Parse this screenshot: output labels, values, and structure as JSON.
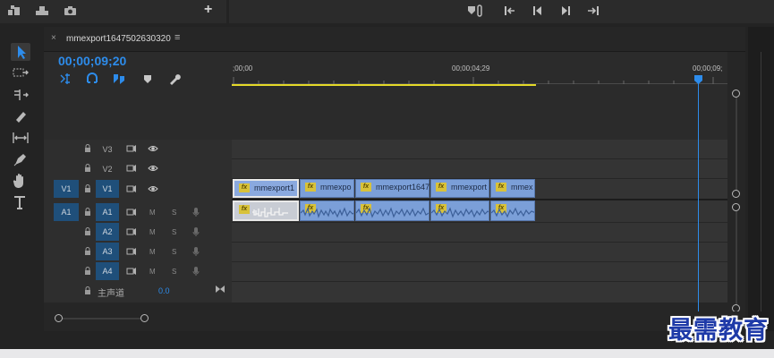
{
  "sequence": {
    "tab_name": "mmexport1647502630320",
    "close_glyph": "×",
    "menu_glyph": "≡",
    "timecode": "00;00;09;20"
  },
  "ruler": {
    "ticks": [
      ";00;00",
      "00;00;04;29",
      "00;00;09;"
    ]
  },
  "tracks": {
    "video": [
      {
        "name": "V3",
        "source": ""
      },
      {
        "name": "V2",
        "source": ""
      },
      {
        "name": "V1",
        "source": "V1"
      }
    ],
    "audio": [
      {
        "name": "A1",
        "source": "A1"
      },
      {
        "name": "A2",
        "source": ""
      },
      {
        "name": "A3",
        "source": ""
      },
      {
        "name": "A4",
        "source": ""
      }
    ],
    "mute_label": "M",
    "solo_label": "S",
    "master_label": "主声道",
    "master_value": "0.0"
  },
  "clips": {
    "video": [
      "mmexport1",
      "mmexpo",
      "mmexport1647",
      "mmexport",
      "mmex"
    ],
    "fx_label": "fx",
    "audio_fx": [
      "fx",
      "fx",
      "fx",
      "fx",
      "fx"
    ]
  },
  "toolbar": {
    "add_label": "+"
  },
  "watermark": "最需教育",
  "colors": {
    "accent_blue": "#2d8ceb",
    "clip_blue": "#7b9fd8",
    "work_area_yellow": "#e5d928",
    "track_target_blue": "#1f4f7a"
  }
}
